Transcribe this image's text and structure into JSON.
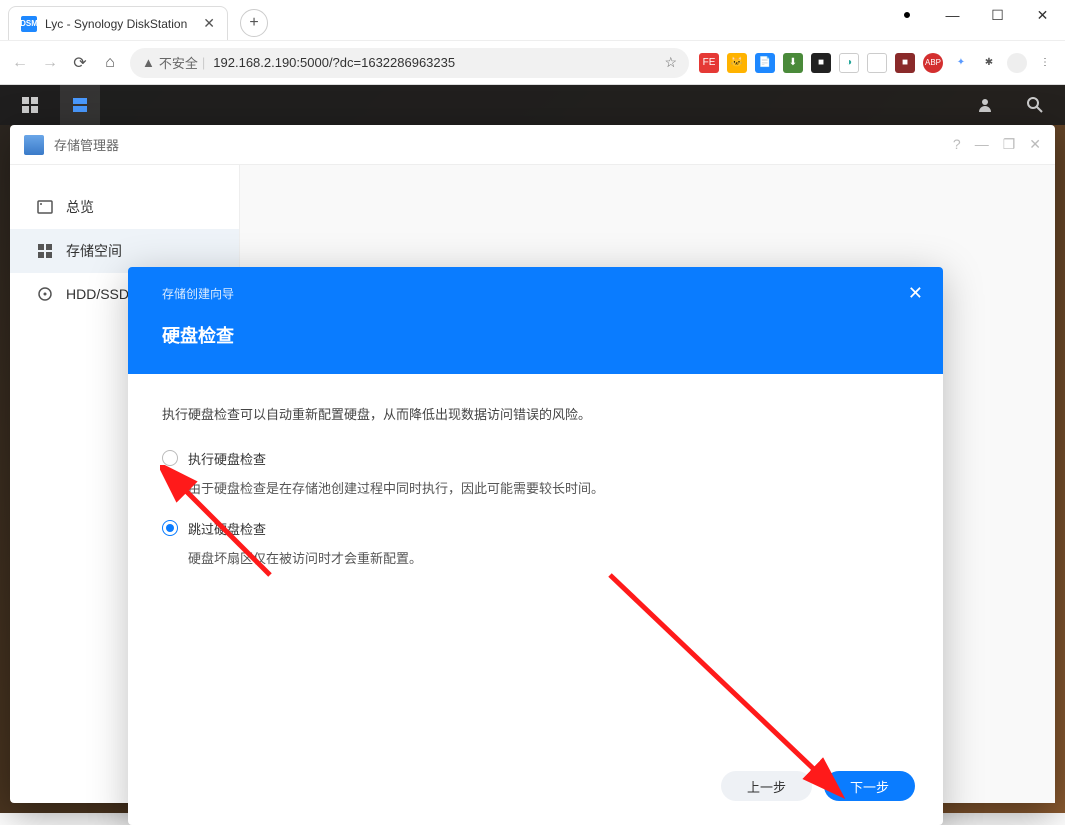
{
  "browser": {
    "tab_title": "Lyc - Synology DiskStation",
    "security_label": "不安全",
    "url": "192.168.2.190:5000/?dc=1632286963235"
  },
  "dsm_window": {
    "title": "存储管理器",
    "sidebar": {
      "items": [
        {
          "label": "总览"
        },
        {
          "label": "存储空间"
        },
        {
          "label": "HDD/SSD"
        }
      ]
    }
  },
  "wizard": {
    "breadcrumb": "存储创建向导",
    "title": "硬盘检查",
    "description": "执行硬盘检查可以自动重新配置硬盘，从而降低出现数据访问错误的风险。",
    "option1": {
      "label": "执行硬盘检查",
      "sub": "由于硬盘检查是在存储池创建过程中同时执行，因此可能需要较长时间。"
    },
    "option2": {
      "label": "跳过硬盘检查",
      "sub": "硬盘坏扇区仅在被访问时才会重新配置。"
    },
    "btn_prev": "上一步",
    "btn_next": "下一步"
  }
}
